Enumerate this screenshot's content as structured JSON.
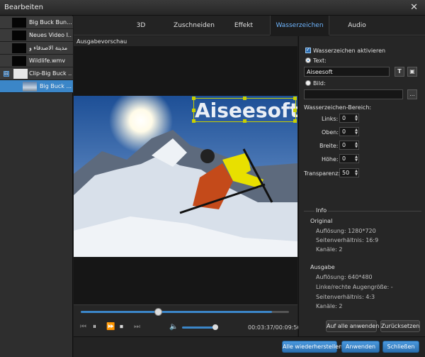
{
  "window": {
    "title": "Bearbeiten",
    "close_glyph": "✕"
  },
  "file_list": {
    "items": [
      {
        "name": "Big Buck Bun..."
      },
      {
        "name": "Neues Video I..."
      },
      {
        "name": "مدينة الاصدقاء و"
      },
      {
        "name": "Wildlife.wmv"
      },
      {
        "name": "Clip-Big Buck ...",
        "expander": "⊟"
      },
      {
        "name": "Big Buck ..."
      }
    ]
  },
  "tabs": [
    {
      "label": "3D"
    },
    {
      "label": "Zuschneiden"
    },
    {
      "label": "Effekt"
    },
    {
      "label": "Wasserzeichen"
    },
    {
      "label": "Audio"
    }
  ],
  "preview": {
    "label": "Ausgabevorschau",
    "watermark_text": "Aiseesoft"
  },
  "player": {
    "seek_progress": 0.37,
    "volume_level": 0.93,
    "time_display": "00:03:37/00:09:56",
    "icons": [
      "skip-back-icon",
      "pause-icon",
      "fast-forward-icon",
      "stop-icon",
      "skip-end-icon",
      "volume-icon"
    ]
  },
  "watermark_panel": {
    "enable_label": "Wasserzeichen aktivieren",
    "text_label": "Text:",
    "text_value": "Aiseesoft",
    "text_font_button": "T",
    "text_color_button": "▣",
    "image_label": "Bild:",
    "image_value": "",
    "browse_button": "...",
    "area_label": "Wasserzeichen-Bereich:",
    "fields": [
      {
        "label": "Links:",
        "value": "0"
      },
      {
        "label": "Oben:",
        "value": "0"
      },
      {
        "label": "Breite:",
        "value": "0"
      },
      {
        "label": "Höhe:",
        "value": "0"
      }
    ],
    "transparency_label": "Transparenz:",
    "transparency_value": "50"
  },
  "info": {
    "title": "Info",
    "original_title": "Original",
    "original_lines": [
      "Auflösung: 1280*720",
      "Seitenverhältnis: 16:9",
      "Kanäle: 2"
    ],
    "output_title": "Ausgabe",
    "output_lines": [
      "Auflösung: 640*480",
      "Linke/rechte Augengröße: -",
      "Seitenverhältnis: 4:3",
      "Kanäle: 2"
    ]
  },
  "buttons": {
    "apply_all": "Auf alle anwenden",
    "reset": "Zurücksetzen",
    "restore_all": "Alle wiederherstellen",
    "apply": "Anwenden",
    "close": "Schließen"
  },
  "colors": {
    "accent": "#3b86c8",
    "tab_active": "#6fb6ff",
    "watermark_box": "#c9d000"
  }
}
